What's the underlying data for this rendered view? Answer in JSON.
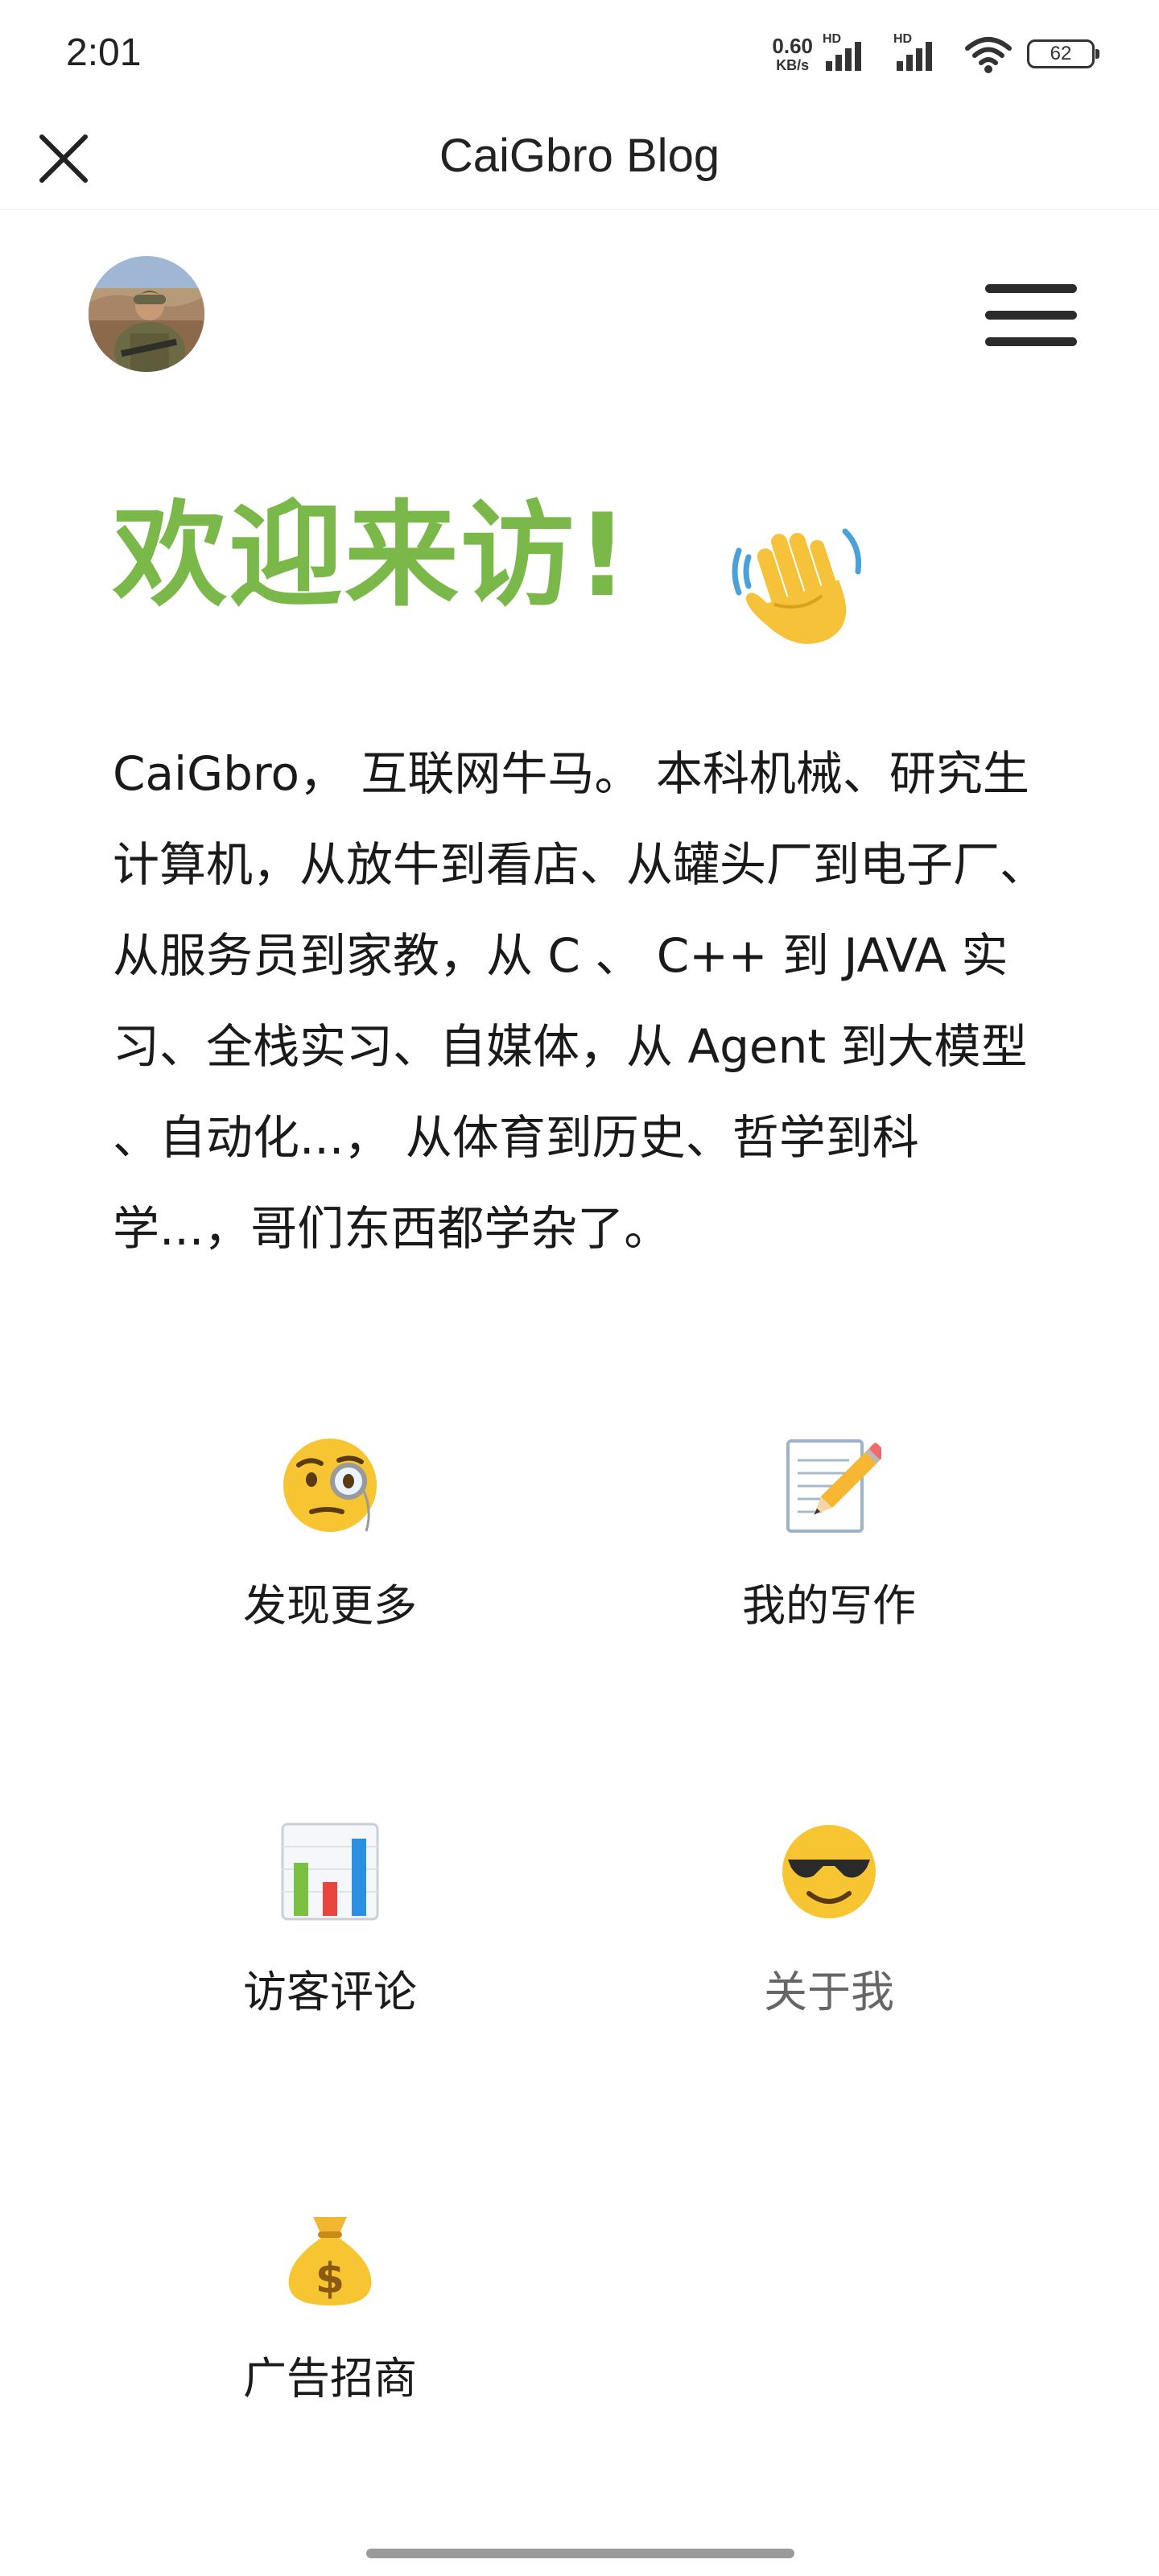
{
  "status_bar": {
    "time": "2:01",
    "net_speed_value": "0.60",
    "net_speed_unit": "KB/s",
    "sim1_label": "HD",
    "sim2_label": "HD",
    "battery": "62"
  },
  "app_bar": {
    "title": "CaiGbro Blog"
  },
  "hero": {
    "title": "欢迎来访!",
    "intro": "CaiGbro， 互联网牛马。 本科机械、研究生计算机，从放牛到看店、从罐头厂到电子厂、从服务员到家教，从 C 、 C++ 到 JAVA 实习、全栈实习、自媒体，从 Agent 到大模型 、自动化...， 从体育到历史、哲学到科学...，哥们东西都学杂了。"
  },
  "nav": [
    {
      "icon": "monocle-face-icon",
      "label": "发现更多"
    },
    {
      "icon": "memo-icon",
      "label": "我的写作"
    },
    {
      "icon": "bar-chart-icon",
      "label": "访客评论"
    },
    {
      "icon": "sunglasses-face-icon",
      "label": "关于我"
    },
    {
      "icon": "money-bag-icon",
      "label": "广告招商"
    }
  ],
  "colors": {
    "accent": "#7ab84a",
    "text": "#1b1b1b",
    "muted": "#666666"
  }
}
